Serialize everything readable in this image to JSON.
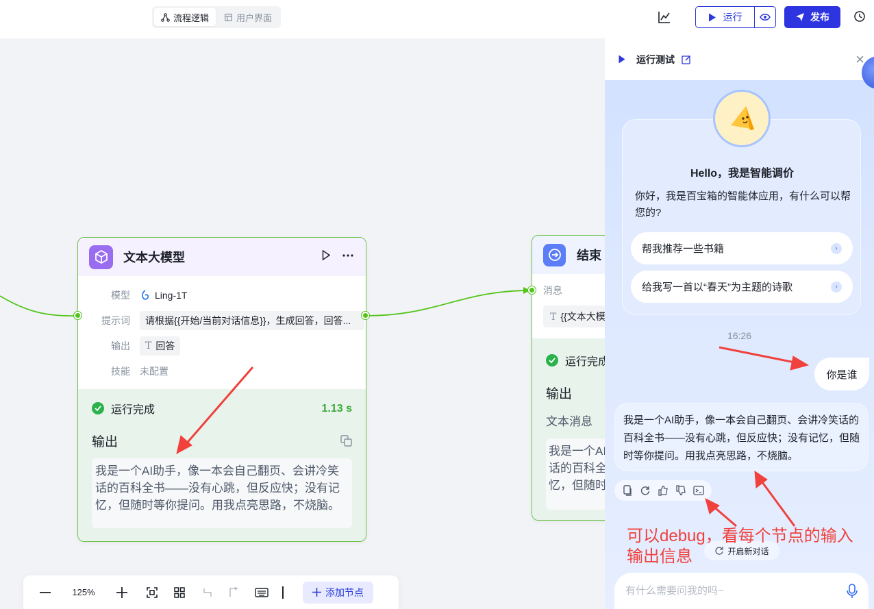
{
  "toolbar": {
    "tabs": [
      {
        "label": "流程逻辑",
        "active": true,
        "icon": "flow-icon"
      },
      {
        "label": "用户界面",
        "active": false,
        "icon": "layout-icon"
      }
    ],
    "run_label": "运行",
    "publish_label": "发布"
  },
  "llm_node": {
    "title": "文本大模型",
    "fields": [
      {
        "key": "模型",
        "value": "Ling-1T"
      },
      {
        "key": "提示词",
        "value": "请根据{{开始/当前对话信息}}，生成回答，回答..."
      },
      {
        "key": "输出",
        "value": "回答"
      },
      {
        "key": "技能",
        "value": "未配置"
      }
    ],
    "status": "运行完成",
    "duration": "1.13 s",
    "output_label": "输出",
    "output_text": "我是一个AI助手，像一本会自己翻页、会讲冷笑话的百科全书——没有心跳，但反应快；没有记忆，但随时等你提问。用我点亮思路，不烧脑。"
  },
  "end_node": {
    "title": "结束",
    "message_label": "消息",
    "message_value": "{{文本大模",
    "status": "运行完成",
    "output_label": "输出",
    "sub_label": "文本消息",
    "output_text": "我是一个AI助手，像一本会自己翻页、会讲冷笑话的百科全书——没有心跳，但反应快；没有记忆，但随时等你提问。"
  },
  "bottom_bar": {
    "zoom": "125%",
    "add_node_label": "添加节点"
  },
  "panel": {
    "title": "运行测试",
    "welcome": {
      "hello": "Hello，我是智能调价",
      "intro": "你好，我是百宝箱的智能体应用，有什么可以帮您的?",
      "suggestions": [
        "帮我推荐一些书籍",
        "给我写一首以“春天”为主题的诗歌"
      ]
    },
    "timestamp": "16:26",
    "user_message": "你是谁",
    "bot_message": "我是一个AI助手，像一本会自己翻页、会讲冷笑话的百科全书——没有心跳，但反应快；没有记忆，但随时等你提问。用我点亮思路，不烧脑。",
    "new_chat_label": "开启新对话",
    "input_placeholder": "有什么需要问我的吗~"
  },
  "annotation": {
    "line1": "可以debug，看每个节点的输入",
    "line2": "输出信息"
  },
  "colors": {
    "primary": "#2d34e0",
    "success": "#52c41a",
    "annotation": "#f0413d"
  }
}
